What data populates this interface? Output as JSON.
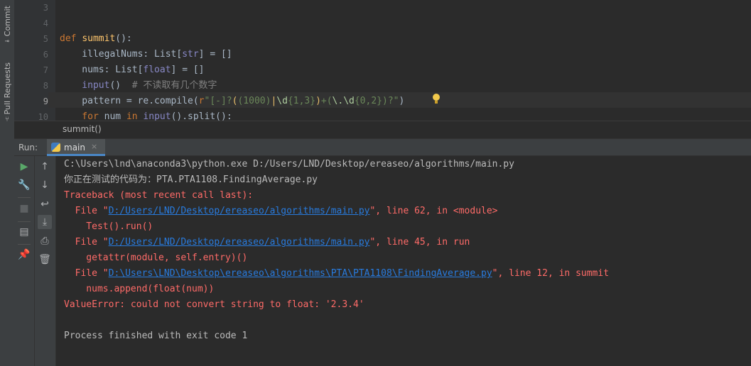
{
  "sidebar": {
    "tabs": [
      {
        "label": "Commit",
        "icon": "commit-icon"
      },
      {
        "label": "Pull Requests",
        "icon": "pull-requests-icon"
      }
    ]
  },
  "editor": {
    "line_numbers": [
      "3",
      "4",
      "5",
      "6",
      "7",
      "8",
      "9",
      "10"
    ],
    "current_line": "9",
    "code": {
      "l5_kw": "def ",
      "l5_fn": "summit",
      "l5_rest": "():",
      "l6_a": "    illegalNums: List[",
      "l6_bi": "str",
      "l6_b": "] = []",
      "l7_a": "    nums: List[",
      "l7_bi": "float",
      "l7_b": "] = []",
      "l8_bi": "    input",
      "l8_a": "()  ",
      "l8_cmt": "# 不读取有几个数字",
      "l9_a": "    pattern = re.compile(",
      "l9_r": "r",
      "l9_s1": "\"[-]?",
      "l9_br1": "(",
      "l9_s2": "(1000)",
      "l9_bar": "|",
      "l9_d": "\\d",
      "l9_q": "{1,3}",
      "l9_br2": ")",
      "l9_s3": "+(",
      "l9_dot": "\\.",
      "l9_d2": "\\d",
      "l9_q2": "{0,2}",
      "l9_s4": ")?\"",
      "l9_end": ")",
      "l10_kw": "    for ",
      "l10_a": "num ",
      "l10_kw2": "in ",
      "l10_bi": "input",
      "l10_b": "().split():"
    }
  },
  "breadcrumb": "summit()",
  "run": {
    "label": "Run:",
    "tab_label": "main",
    "close": "×"
  },
  "toolbar": {
    "buttons": [
      "rerun",
      "modify-config",
      "stop",
      "layout",
      "pin",
      "up",
      "down",
      "soft-wrap",
      "scroll-to-end",
      "print",
      "clear"
    ]
  },
  "console": {
    "cmd": "C:\\Users\\lnd\\anaconda3\\python.exe D:/Users/LND/Desktop/ereaseo/algorithms/main.py",
    "testing": "你正在测试的代码为：PTA.PTA1108.FindingAverage.py",
    "traceback": "Traceback (most recent call last):",
    "frame1_pre": "  File \"",
    "frame1_link": "D:/Users/LND/Desktop/ereaseo/algorithms/main.py",
    "frame1_post": "\", line 62, in <module>",
    "frame1_code": "    Test().run()",
    "frame2_pre": "  File \"",
    "frame2_link": "D:/Users/LND/Desktop/ereaseo/algorithms/main.py",
    "frame2_post": "\", line 45, in run",
    "frame2_code": "    getattr(module, self.entry)()",
    "frame3_pre": "  File \"",
    "frame3_link": "D:\\Users\\LND\\Desktop\\ereaseo\\algorithms\\PTA\\PTA1108\\FindingAverage.py",
    "frame3_post": "\", line 12, in summit",
    "frame3_code": "    nums.append(float(num))",
    "error": "ValueError: could not convert string to float: '2.3.4'",
    "exit": "Process finished with exit code 1"
  },
  "colors": {
    "background": "#2b2b2b",
    "panel": "#3c3f41",
    "error": "#ff6b68",
    "link": "#287bde",
    "keyword": "#cc7832",
    "function": "#ffc66d",
    "run_green": "#59a869"
  }
}
